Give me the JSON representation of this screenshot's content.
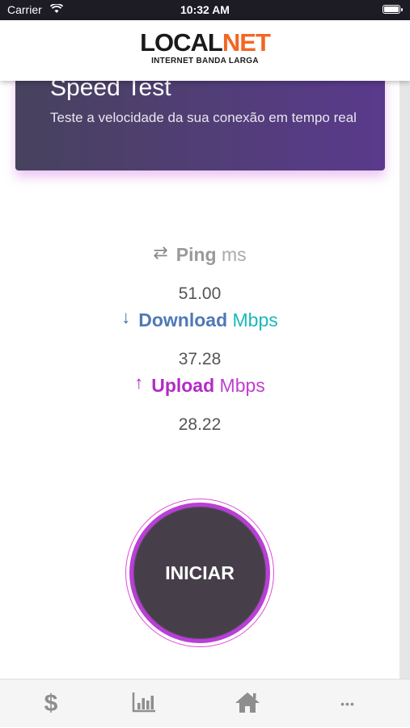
{
  "status_bar": {
    "carrier": "Carrier",
    "time": "10:32 AM"
  },
  "header": {
    "logo_part1": "LOCAL",
    "logo_part2": "NET",
    "logo_tagline": "INTERNET BANDA LARGA",
    "colors": {
      "brand_orange": "#f26722",
      "brand_dark": "#1a1a1a"
    }
  },
  "banner": {
    "title": "Speed Test",
    "description": "Teste a velocidade da sua conexão em tempo real",
    "colors": {
      "gradient_start": "#47425e",
      "gradient_end": "#5a3a8c"
    }
  },
  "metrics": {
    "ping": {
      "icon": "swap-arrows-icon",
      "label": "Ping",
      "unit": "ms",
      "value": "51.00"
    },
    "download": {
      "icon": "arrow-down-icon",
      "label": "Download",
      "unit": "Mbps",
      "value": "37.28"
    },
    "upload": {
      "icon": "arrow-up-icon",
      "label": "Upload",
      "unit": "Mbps",
      "value": "28.22"
    }
  },
  "start_button": {
    "label": "INICIAR",
    "colors": {
      "fill": "#463f4a",
      "ring": "#b93fd6"
    }
  },
  "tab_bar": {
    "items": [
      {
        "icon": "dollar-icon",
        "glyph": "$"
      },
      {
        "icon": "bar-chart-icon"
      },
      {
        "icon": "home-icon"
      },
      {
        "icon": "more-icon",
        "glyph": "•••"
      }
    ]
  }
}
